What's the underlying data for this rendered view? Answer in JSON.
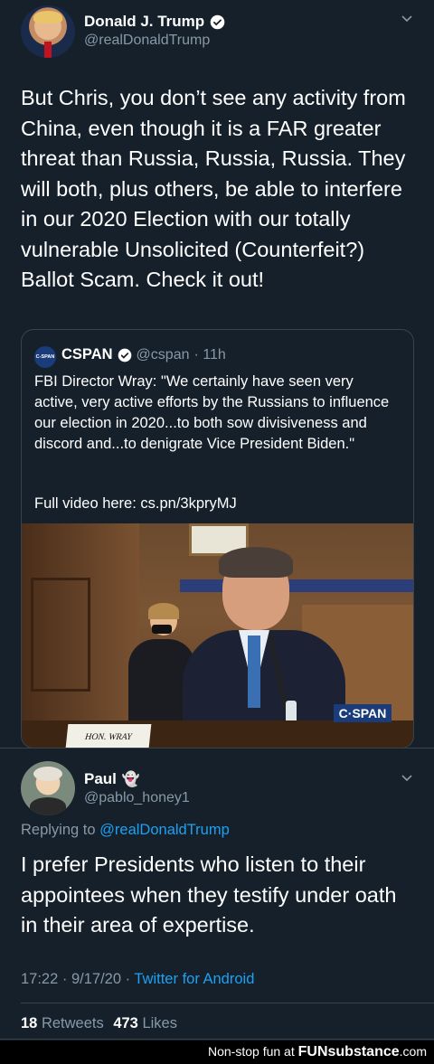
{
  "tweet": {
    "author_name": "Donald J. Trump",
    "author_handle": "@realDonaldTrump",
    "text": "But Chris, you don’t see any activity from China, even though it is a FAR greater threat than Russia, Russia, Russia. They will both, plus others, be able to interfere in our 2020 Election with our totally vulnerable Unsolicited (Counterfeit?) Ballot Scam. Check it out!"
  },
  "quote": {
    "logo_text": "C-SPAN",
    "name": "CSPAN",
    "handle": "@cspan",
    "time": "· 11h",
    "text": "FBI Director Wray: \"We certainly have seen very active, very active efforts by the Russians to influence our election in 2020...to both sow divisiveness and discord and...to denigrate Vice President Biden.\"",
    "video_line": "Full video here: cs.pn/3kpryMJ",
    "media_watermark": "C·SPAN",
    "nameplate": "HON. WRAY"
  },
  "reply": {
    "author_name": "Paul",
    "author_emoji": "👻",
    "author_handle": "@pablo_honey1",
    "replying_prefix": "Replying to",
    "replying_handle": "@realDonaldTrump",
    "text": "I prefer Presidents who listen to their appointees when they testify under oath in their area of expertise.",
    "timestamp": "17:22 · 9/17/20 ·",
    "source": "Twitter for Android",
    "retweets_count": "18",
    "retweets_label": "Retweets",
    "likes_count": "473",
    "likes_label": "Likes"
  },
  "footer": {
    "prefix": "Non-stop fun at",
    "brand": "FUNsubstance",
    "suffix": ".com"
  }
}
